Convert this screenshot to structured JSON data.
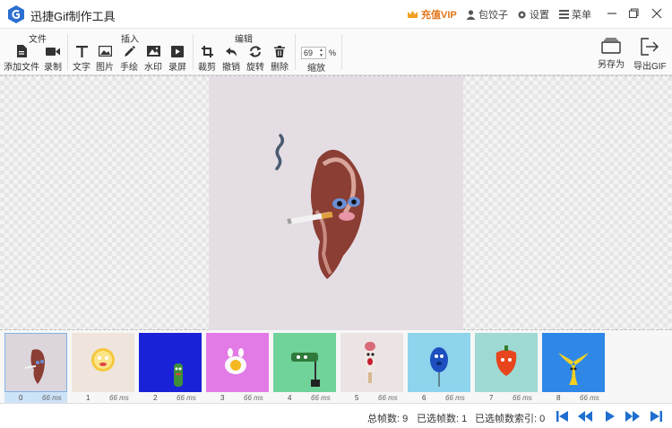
{
  "app": {
    "title": "迅捷Gif制作工具"
  },
  "titlebar": {
    "vip": "充值VIP",
    "user": "包饺子",
    "settings": "设置",
    "menu": "菜单"
  },
  "toolbar": {
    "groups": {
      "file": "文件",
      "insert": "插入",
      "edit": "编辑"
    },
    "add_file": "添加文件",
    "record": "录制",
    "text": "文字",
    "image": "图片",
    "draw": "手绘",
    "watermark": "水印",
    "screen": "录屏",
    "crop": "裁剪",
    "undo": "撤销",
    "rotate": "旋转",
    "delete": "删除",
    "zoom_value": "69",
    "zoom_unit": "%",
    "zoom_label": "缩放",
    "save_as": "另存为",
    "export_gif": "导出GIF"
  },
  "frames": [
    {
      "index": "0",
      "duration": "66 ms",
      "bg": "#dcd6dc",
      "subject": "bacon"
    },
    {
      "index": "1",
      "duration": "66 ms",
      "bg": "#efe5dc",
      "subject": "lemon"
    },
    {
      "index": "2",
      "duration": "66 ms",
      "bg": "#1a22d8",
      "subject": "cactus"
    },
    {
      "index": "3",
      "duration": "66 ms",
      "bg": "#e37be6",
      "subject": "egg"
    },
    {
      "index": "4",
      "duration": "66 ms",
      "bg": "#6fd39a",
      "subject": "roller"
    },
    {
      "index": "5",
      "duration": "66 ms",
      "bg": "#ece4e4",
      "subject": "popsicle"
    },
    {
      "index": "6",
      "duration": "66 ms",
      "bg": "#8dd4ec",
      "subject": "balloon"
    },
    {
      "index": "7",
      "duration": "66 ms",
      "bg": "#9fd9d4",
      "subject": "pepper"
    },
    {
      "index": "8",
      "duration": "66 ms",
      "bg": "#2f88e8",
      "subject": "banana"
    }
  ],
  "status": {
    "total": "总帧数: 9",
    "selected": "已选帧数: 1",
    "selected_index": "已选帧数索引: 0"
  },
  "colors": {
    "accent": "#1f6fd0",
    "vip": "#e2761a"
  }
}
